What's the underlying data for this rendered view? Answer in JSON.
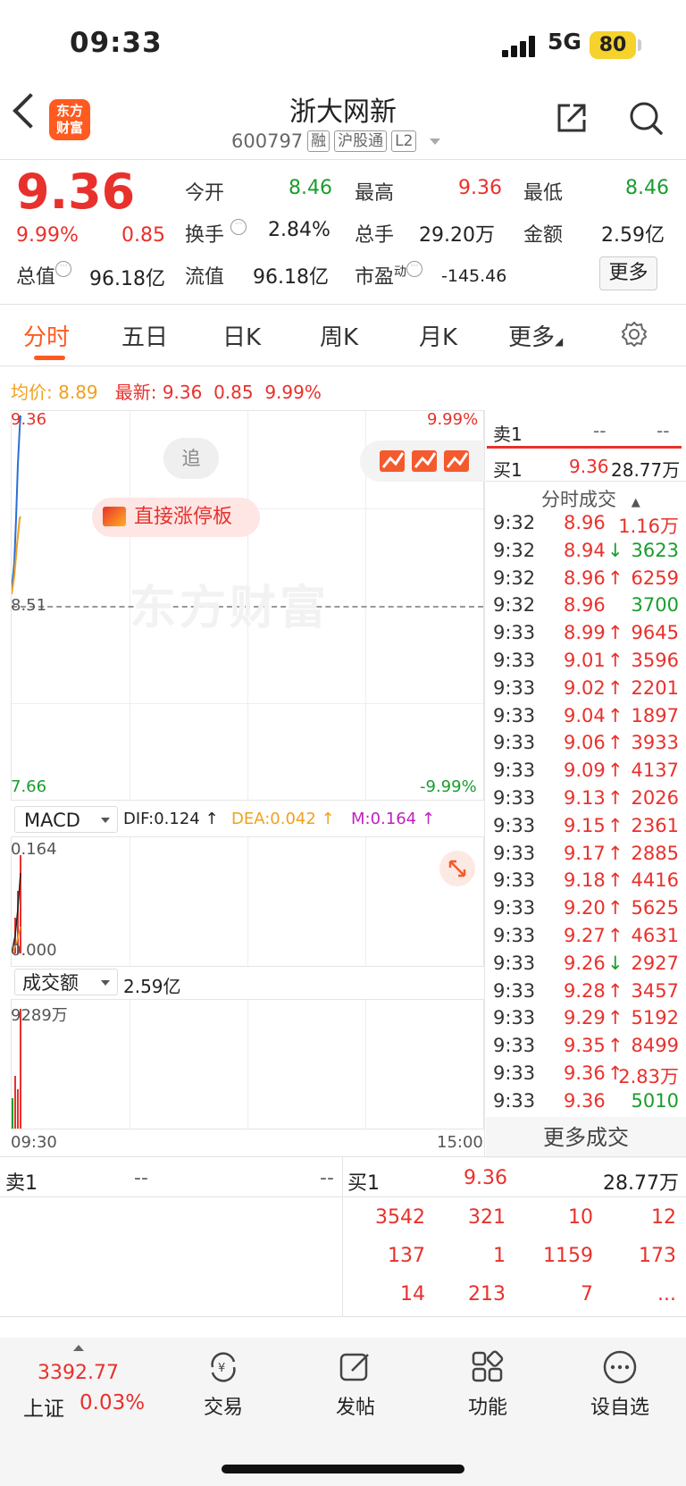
{
  "status_bar": {
    "time": "09:33",
    "network": "5G",
    "battery": "80"
  },
  "header": {
    "logo_line1": "东方",
    "logo_line2": "财富",
    "stock_name": "浙大网新",
    "code": "600797",
    "tags": [
      "融",
      "沪股通",
      "L2"
    ]
  },
  "quote": {
    "price": "9.36",
    "change_pct": "9.99%",
    "change": "0.85",
    "open_label": "今开",
    "open": "8.46",
    "high_label": "最高",
    "high": "9.36",
    "low_label": "最低",
    "low": "8.46",
    "turnover_label": "换手",
    "turnover": "2.84%",
    "volume_label": "总手",
    "volume": "29.20万",
    "amount_label": "金额",
    "amount": "2.59亿",
    "mktcap_label": "总值",
    "mktcap": "96.18亿",
    "float_label": "流值",
    "float": "96.18亿",
    "pe_label": "市盈",
    "pe_sup": "动",
    "pe": "-145.46",
    "more": "更多"
  },
  "tabs": [
    "分时",
    "五日",
    "日K",
    "周K",
    "月K",
    "更多"
  ],
  "chart_info": {
    "avg_label": "均价:",
    "avg": "8.89",
    "latest_label": "最新:",
    "latest": "9.36",
    "chg": "0.85",
    "pct": "9.99%"
  },
  "chart": {
    "top_price": "9.36",
    "top_pct": "9.99%",
    "mid_price": "8.51",
    "bottom_price": "7.66",
    "bottom_pct": "-9.99%",
    "chase": "追",
    "limit_up": "直接涨停板",
    "watermark": "东方财富",
    "time_start": "09:30",
    "time_end": "15:00"
  },
  "macd": {
    "selector": "MACD",
    "dif": "DIF:0.124 ↑",
    "dea": "DEA:0.042 ↑",
    "m": "M:0.164 ↑",
    "top": "0.164",
    "bottom": "0.000"
  },
  "volume_panel": {
    "selector": "成交额",
    "value": "2.59亿",
    "max": "9289万"
  },
  "right_panel": {
    "sell1_label": "卖1",
    "sell1_price": "--",
    "sell1_vol": "--",
    "buy1_label": "买1",
    "buy1_price": "9.36",
    "buy1_vol": "28.77万",
    "trades_title": "分时成交",
    "trades": [
      {
        "t": "9:32",
        "p": "8.96",
        "d": "",
        "v": "1.16万",
        "c": "red"
      },
      {
        "t": "9:32",
        "p": "8.94",
        "d": "↓",
        "v": "3623",
        "c": "green"
      },
      {
        "t": "9:32",
        "p": "8.96",
        "d": "↑",
        "v": "6259",
        "c": "red"
      },
      {
        "t": "9:32",
        "p": "8.96",
        "d": "",
        "v": "3700",
        "c": "green"
      },
      {
        "t": "9:33",
        "p": "8.99",
        "d": "↑",
        "v": "9645",
        "c": "red"
      },
      {
        "t": "9:33",
        "p": "9.01",
        "d": "↑",
        "v": "3596",
        "c": "red"
      },
      {
        "t": "9:33",
        "p": "9.02",
        "d": "↑",
        "v": "2201",
        "c": "red"
      },
      {
        "t": "9:33",
        "p": "9.04",
        "d": "↑",
        "v": "1897",
        "c": "red"
      },
      {
        "t": "9:33",
        "p": "9.06",
        "d": "↑",
        "v": "3933",
        "c": "red"
      },
      {
        "t": "9:33",
        "p": "9.09",
        "d": "↑",
        "v": "4137",
        "c": "red"
      },
      {
        "t": "9:33",
        "p": "9.13",
        "d": "↑",
        "v": "2026",
        "c": "red"
      },
      {
        "t": "9:33",
        "p": "9.15",
        "d": "↑",
        "v": "2361",
        "c": "red"
      },
      {
        "t": "9:33",
        "p": "9.17",
        "d": "↑",
        "v": "2885",
        "c": "red"
      },
      {
        "t": "9:33",
        "p": "9.18",
        "d": "↑",
        "v": "4416",
        "c": "red"
      },
      {
        "t": "9:33",
        "p": "9.20",
        "d": "↑",
        "v": "5625",
        "c": "red"
      },
      {
        "t": "9:33",
        "p": "9.27",
        "d": "↑",
        "v": "4631",
        "c": "red"
      },
      {
        "t": "9:33",
        "p": "9.26",
        "d": "↓",
        "v": "2927",
        "c": "red"
      },
      {
        "t": "9:33",
        "p": "9.28",
        "d": "↑",
        "v": "3457",
        "c": "red"
      },
      {
        "t": "9:33",
        "p": "9.29",
        "d": "↑",
        "v": "5192",
        "c": "red"
      },
      {
        "t": "9:33",
        "p": "9.35",
        "d": "↑",
        "v": "8499",
        "c": "red"
      },
      {
        "t": "9:33",
        "p": "9.36",
        "d": "↑",
        "v": "2.83万",
        "c": "red"
      },
      {
        "t": "9:33",
        "p": "9.36",
        "d": "",
        "v": "5010",
        "c": "green"
      }
    ],
    "more_trades": "更多成交"
  },
  "order_book": {
    "sell_label": "卖1",
    "sell_price": "--",
    "sell_vol": "--",
    "buy_label": "买1",
    "buy_price": "9.36",
    "buy_vol": "28.77万",
    "queue": [
      [
        "3542",
        "321",
        "10",
        "12"
      ],
      [
        "137",
        "1",
        "1159",
        "173"
      ],
      [
        "14",
        "213",
        "7",
        "..."
      ]
    ]
  },
  "footer": {
    "index_value": "3392.77",
    "index_name": "上证",
    "index_pct": "0.03%",
    "trade": "交易",
    "post": "发帖",
    "function": "功能",
    "watchlist": "设自选"
  },
  "colors": {
    "up": "#e8312c",
    "down": "#1a9d2e",
    "accent": "#ff5a1f",
    "avg": "#f0a020",
    "dea": "#f0a020",
    "m": "#c020c0"
  }
}
